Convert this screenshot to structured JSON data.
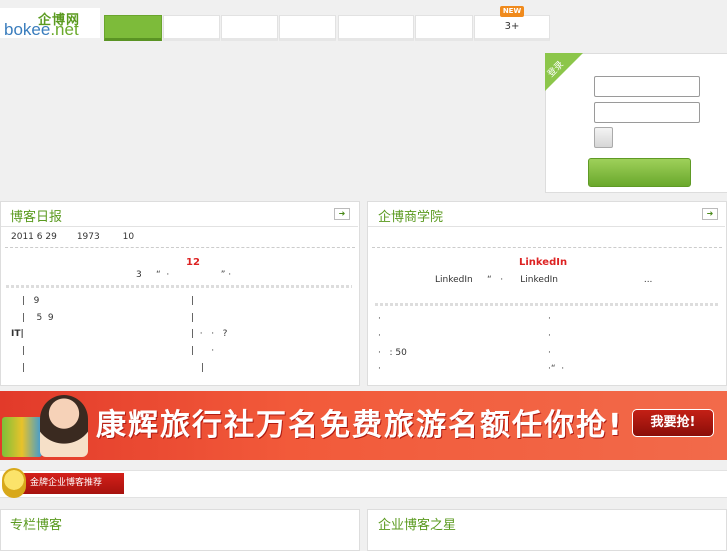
{
  "header": {
    "logo_cn": "企博网",
    "logo_en_left": "bokee",
    "logo_en_right": ".net",
    "nav_tabs": [
      "",
      "",
      "",
      "",
      "",
      "",
      "3+"
    ],
    "new_badge": "NEW"
  },
  "login": {
    "corner_label": "登录",
    "username_value": "",
    "password_value": "",
    "submit_label": ""
  },
  "blog_daily": {
    "title": "博客日报",
    "arrow": "➜",
    "headline": "2011 6 29       1973        10",
    "feature_title": "12",
    "feature_sub": "3     “  ·                  ” ·",
    "list": [
      {
        "left": "|   9",
        "right": "|"
      },
      {
        "left": "|    5  9",
        "right": "|"
      },
      {
        "left": "IT|",
        "right": "|  ·   ·   ?"
      },
      {
        "left": "|",
        "right": "|      ·"
      },
      {
        "left": "|",
        "right": "|"
      }
    ]
  },
  "academy": {
    "title": "企博商学院",
    "arrow": "➜",
    "feature_title": "LinkedIn",
    "feature_sub": "LinkedIn     “   ·      LinkedIn                              ...",
    "list": [
      {
        "left": "·",
        "right": "·"
      },
      {
        "left": "·",
        "right": "·"
      },
      {
        "left": "·   : 50",
        "right": "·"
      },
      {
        "left": "·",
        "right": "·“  ·"
      }
    ]
  },
  "banner": {
    "text": "康辉旅行社万名免费旅游名额任你抢!",
    "button": "我要抢!"
  },
  "gold": {
    "label": "金牌企业博客推荐"
  },
  "columns": {
    "left_title": "专栏博客",
    "right_title": "企业博客之星"
  }
}
